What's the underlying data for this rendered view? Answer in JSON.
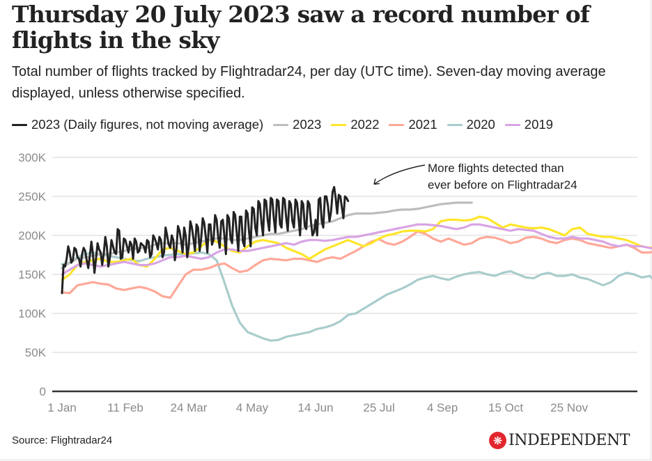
{
  "title": "Thursday 20 July 2023 saw a record number of flights in the sky",
  "subtitle": "Total number of flights tracked by Flightradar24, per day (UTC time). Seven-day moving average displayed, unless otherwise specified.",
  "source": "Source: Flightradar24",
  "logo": {
    "icon": "eagle-icon",
    "text": "INDEPENDENT"
  },
  "chart_data": {
    "type": "line",
    "title": "Thursday 20 July 2023 saw a record number of flights in the sky",
    "xlabel": "",
    "ylabel": "",
    "x_unit": "day of year (0 = 1 Jan)",
    "y_unit": "flights per day (thousands)",
    "ylim": [
      0,
      300
    ],
    "xlim": [
      0,
      364
    ],
    "grid": true,
    "legend_position": "top",
    "y_ticks": [
      {
        "value": 0,
        "label": "0"
      },
      {
        "value": 50,
        "label": "50K"
      },
      {
        "value": 100,
        "label": "100K"
      },
      {
        "value": 150,
        "label": "150K"
      },
      {
        "value": 200,
        "label": "200K"
      },
      {
        "value": 250,
        "label": "250K"
      },
      {
        "value": 300,
        "label": "300K"
      }
    ],
    "x_ticks": [
      {
        "day": 0,
        "label": "1 Jan"
      },
      {
        "day": 41,
        "label": "11 Feb"
      },
      {
        "day": 82,
        "label": "24 Mar"
      },
      {
        "day": 123,
        "label": "4 May"
      },
      {
        "day": 164,
        "label": "14 Jun"
      },
      {
        "day": 205,
        "label": "25 Jul"
      },
      {
        "day": 246,
        "label": "4 Sep"
      },
      {
        "day": 287,
        "label": "15 Oct"
      },
      {
        "day": 328,
        "label": "25 Nov"
      }
    ],
    "annotation": {
      "text_lines": [
        "More flights detected than",
        "ever before on Flightradar24"
      ],
      "day": 200,
      "value": 262
    },
    "series": [
      {
        "name": "2020",
        "color": "#a9cccc",
        "step_days": 5,
        "values": [
          163,
          165,
          172,
          176,
          178,
          176,
          174,
          172,
          170,
          168,
          167,
          170,
          172,
          174,
          175,
          176,
          176,
          177,
          178,
          176,
          168,
          140,
          110,
          88,
          76,
          72,
          68,
          65,
          66,
          70,
          72,
          74,
          76,
          80,
          82,
          85,
          90,
          98,
          100,
          106,
          112,
          118,
          124,
          128,
          132,
          137,
          143,
          146,
          148,
          145,
          143,
          147,
          150,
          152,
          153,
          150,
          148,
          152,
          154,
          150,
          146,
          145,
          150,
          152,
          148,
          148,
          150,
          146,
          144,
          140,
          136,
          140,
          148,
          152,
          150,
          146,
          148,
          140,
          138,
          145,
          150,
          152,
          148,
          140,
          146,
          150,
          147,
          138,
          130,
          128
        ]
      },
      {
        "name": "2021",
        "color": "#ffa898",
        "step_days": 5,
        "values": [
          127,
          126,
          136,
          138,
          140,
          138,
          137,
          132,
          130,
          132,
          134,
          132,
          128,
          122,
          120,
          135,
          150,
          156,
          156,
          158,
          162,
          164,
          158,
          153,
          155,
          162,
          168,
          170,
          169,
          168,
          170,
          170,
          168,
          166,
          170,
          172,
          170,
          175,
          180,
          186,
          192,
          195,
          190,
          188,
          192,
          198,
          205,
          202,
          196,
          192,
          196,
          192,
          188,
          190,
          196,
          198,
          197,
          194,
          190,
          192,
          197,
          198,
          196,
          192,
          190,
          194,
          196,
          194,
          190,
          188,
          186,
          184,
          186,
          188,
          184,
          178,
          178,
          180,
          182,
          176,
          174,
          178,
          178,
          180,
          178,
          176,
          172,
          160,
          146,
          142
        ]
      },
      {
        "name": "2022",
        "color": "#ffe52a",
        "step_days": 5,
        "values": [
          143,
          150,
          162,
          166,
          168,
          170,
          166,
          166,
          168,
          170,
          162,
          160,
          170,
          182,
          184,
          180,
          176,
          178,
          186,
          194,
          192,
          186,
          180,
          178,
          186,
          192,
          194,
          192,
          190,
          184,
          180,
          176,
          170,
          176,
          182,
          186,
          190,
          194,
          190,
          186,
          190,
          196,
          200,
          202,
          205,
          206,
          206,
          205,
          208,
          218,
          220,
          220,
          219,
          220,
          224,
          222,
          216,
          210,
          214,
          212,
          210,
          209,
          210,
          208,
          204,
          200,
          208,
          210,
          202,
          200,
          198,
          198,
          196,
          194,
          190,
          186,
          184,
          186,
          186,
          180,
          172,
          174,
          182,
          184,
          180,
          178,
          176,
          150,
          144,
          152
        ]
      },
      {
        "name": "2019",
        "color": "#d8a4e4",
        "step_days": 5,
        "values": [
          150,
          156,
          162,
          164,
          162,
          160,
          162,
          164,
          166,
          164,
          162,
          162,
          164,
          168,
          172,
          172,
          174,
          172,
          170,
          172,
          178,
          182,
          182,
          180,
          180,
          182,
          184,
          186,
          188,
          190,
          188,
          192,
          194,
          194,
          193,
          194,
          196,
          198,
          198,
          200,
          202,
          204,
          206,
          208,
          210,
          212,
          214,
          214,
          213,
          212,
          210,
          208,
          210,
          214,
          214,
          212,
          210,
          208,
          206,
          208,
          207,
          206,
          202,
          198,
          196,
          196,
          198,
          196,
          196,
          194,
          192,
          188,
          186,
          188,
          186,
          186,
          184,
          182,
          178,
          178,
          186,
          184,
          182,
          184,
          184,
          182,
          186,
          172,
          162,
          160
        ]
      },
      {
        "name": "2023",
        "color": "#bdbdbd",
        "step_days": 5,
        "values": [
          158,
          165,
          170,
          172,
          174,
          176,
          176,
          178,
          180,
          182,
          184,
          184,
          188,
          190,
          190,
          190,
          188,
          190,
          192,
          194,
          196,
          196,
          194,
          194,
          196,
          198,
          200,
          202,
          202,
          204,
          206,
          208,
          212,
          214,
          216,
          218,
          222,
          226,
          228,
          228,
          228,
          229,
          230,
          232,
          233,
          233,
          234,
          236,
          238,
          240,
          241,
          242,
          242,
          242
        ]
      },
      {
        "name": "2023 (Daily figures, not moving average)",
        "color": "#222222",
        "step_days": 1,
        "values": [
          126,
          162,
          160,
          170,
          186,
          178,
          165,
          168,
          184,
          182,
          172,
          170,
          160,
          176,
          184,
          180,
          168,
          158,
          174,
          192,
          176,
          152,
          170,
          190,
          182,
          178,
          162,
          176,
          198,
          186,
          160,
          172,
          194,
          186,
          178,
          176,
          208,
          206,
          170,
          172,
          196,
          194,
          186,
          178,
          192,
          188,
          170,
          196,
          192,
          178,
          180,
          190,
          188,
          186,
          178,
          194,
          192,
          172,
          176,
          200,
          196,
          190,
          182,
          198,
          194,
          172,
          178,
          210,
          200,
          188,
          184,
          200,
          194,
          168,
          182,
          212,
          206,
          194,
          178,
          210,
          200,
          172,
          186,
          218,
          210,
          196,
          180,
          214,
          210,
          180,
          196,
          222,
          216,
          198,
          178,
          214,
          214,
          188,
          194,
          226,
          220,
          198,
          184,
          218,
          220,
          200,
          176,
          226,
          222,
          196,
          190,
          230,
          226,
          204,
          180,
          224,
          224,
          192,
          186,
          232,
          228,
          204,
          186,
          236,
          234,
          210,
          200,
          244,
          240,
          216,
          200,
          246,
          244,
          220,
          206,
          248,
          246,
          222,
          204,
          246,
          244,
          214,
          210,
          248,
          246,
          222,
          206,
          244,
          240,
          218,
          210,
          246,
          242,
          222,
          200,
          244,
          240,
          212,
          208,
          244,
          240,
          218,
          200,
          204,
          220,
          200,
          246,
          248,
          218,
          210,
          250,
          250,
          238,
          218,
          230,
          256,
          262,
          248,
          228,
          252,
          250,
          236,
          222,
          250,
          248,
          244
        ]
      }
    ]
  }
}
